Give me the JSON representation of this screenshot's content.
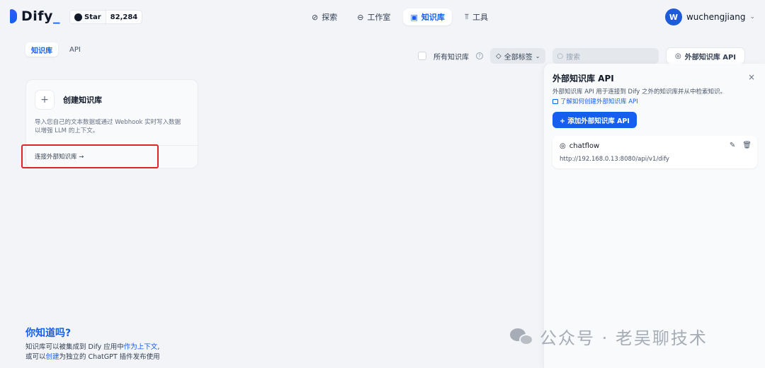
{
  "app": {
    "name_main": "Dify",
    "name_suffix": "_",
    "github_star_label": "Star",
    "github_star_count": "82,284"
  },
  "nav": [
    {
      "label": "探索",
      "icon": "compass-icon",
      "active": false
    },
    {
      "label": "工作室",
      "icon": "robot-icon",
      "active": false
    },
    {
      "label": "知识库",
      "icon": "book-icon",
      "active": true
    },
    {
      "label": "工具",
      "icon": "hammer-icon",
      "active": false
    }
  ],
  "user": {
    "initial": "W",
    "name": "wuchengjiang"
  },
  "subtabs": [
    {
      "label": "知识库",
      "active": true
    },
    {
      "label": "API",
      "active": false
    }
  ],
  "filters": {
    "all_kb_label": "所有知识库",
    "tags_label": "全部标签",
    "search_placeholder": "搜索",
    "external_api_button": "外部知识库 API"
  },
  "create_card": {
    "title": "创建知识库",
    "desc_line1": "导入您自己的文本数据或通过 Webhook 实时写入数据",
    "desc_line2": "以增强 LLM 的上下文。",
    "connect_label": "连接外部知识库 →"
  },
  "panel": {
    "title": "外部知识库 API",
    "close": "×",
    "description": "外部知识库 API 用于连接到 Dify 之外的知识库并从中检索知识。",
    "learn_link": "了解如何创建外部知识库 API",
    "add_button": "+ 添加外部知识库 API",
    "apis": [
      {
        "name": "chatflow",
        "url": "http://192.168.0.13:8080/api/v1/dify"
      }
    ]
  },
  "tip": {
    "title": "你知道吗?",
    "line1_a": "知识库可以被集成到 Dify 应用中",
    "line1_link": "作为上下文",
    "line1_b": ",",
    "line2_a": "或可以",
    "line2_link": "创建",
    "line2_b": "为独立的 ChatGPT 插件发布使用"
  },
  "watermark": {
    "text": "公众号 · 老吴聊技术"
  },
  "colors": {
    "accent": "#155eef",
    "highlight_box": "#e0241f"
  }
}
